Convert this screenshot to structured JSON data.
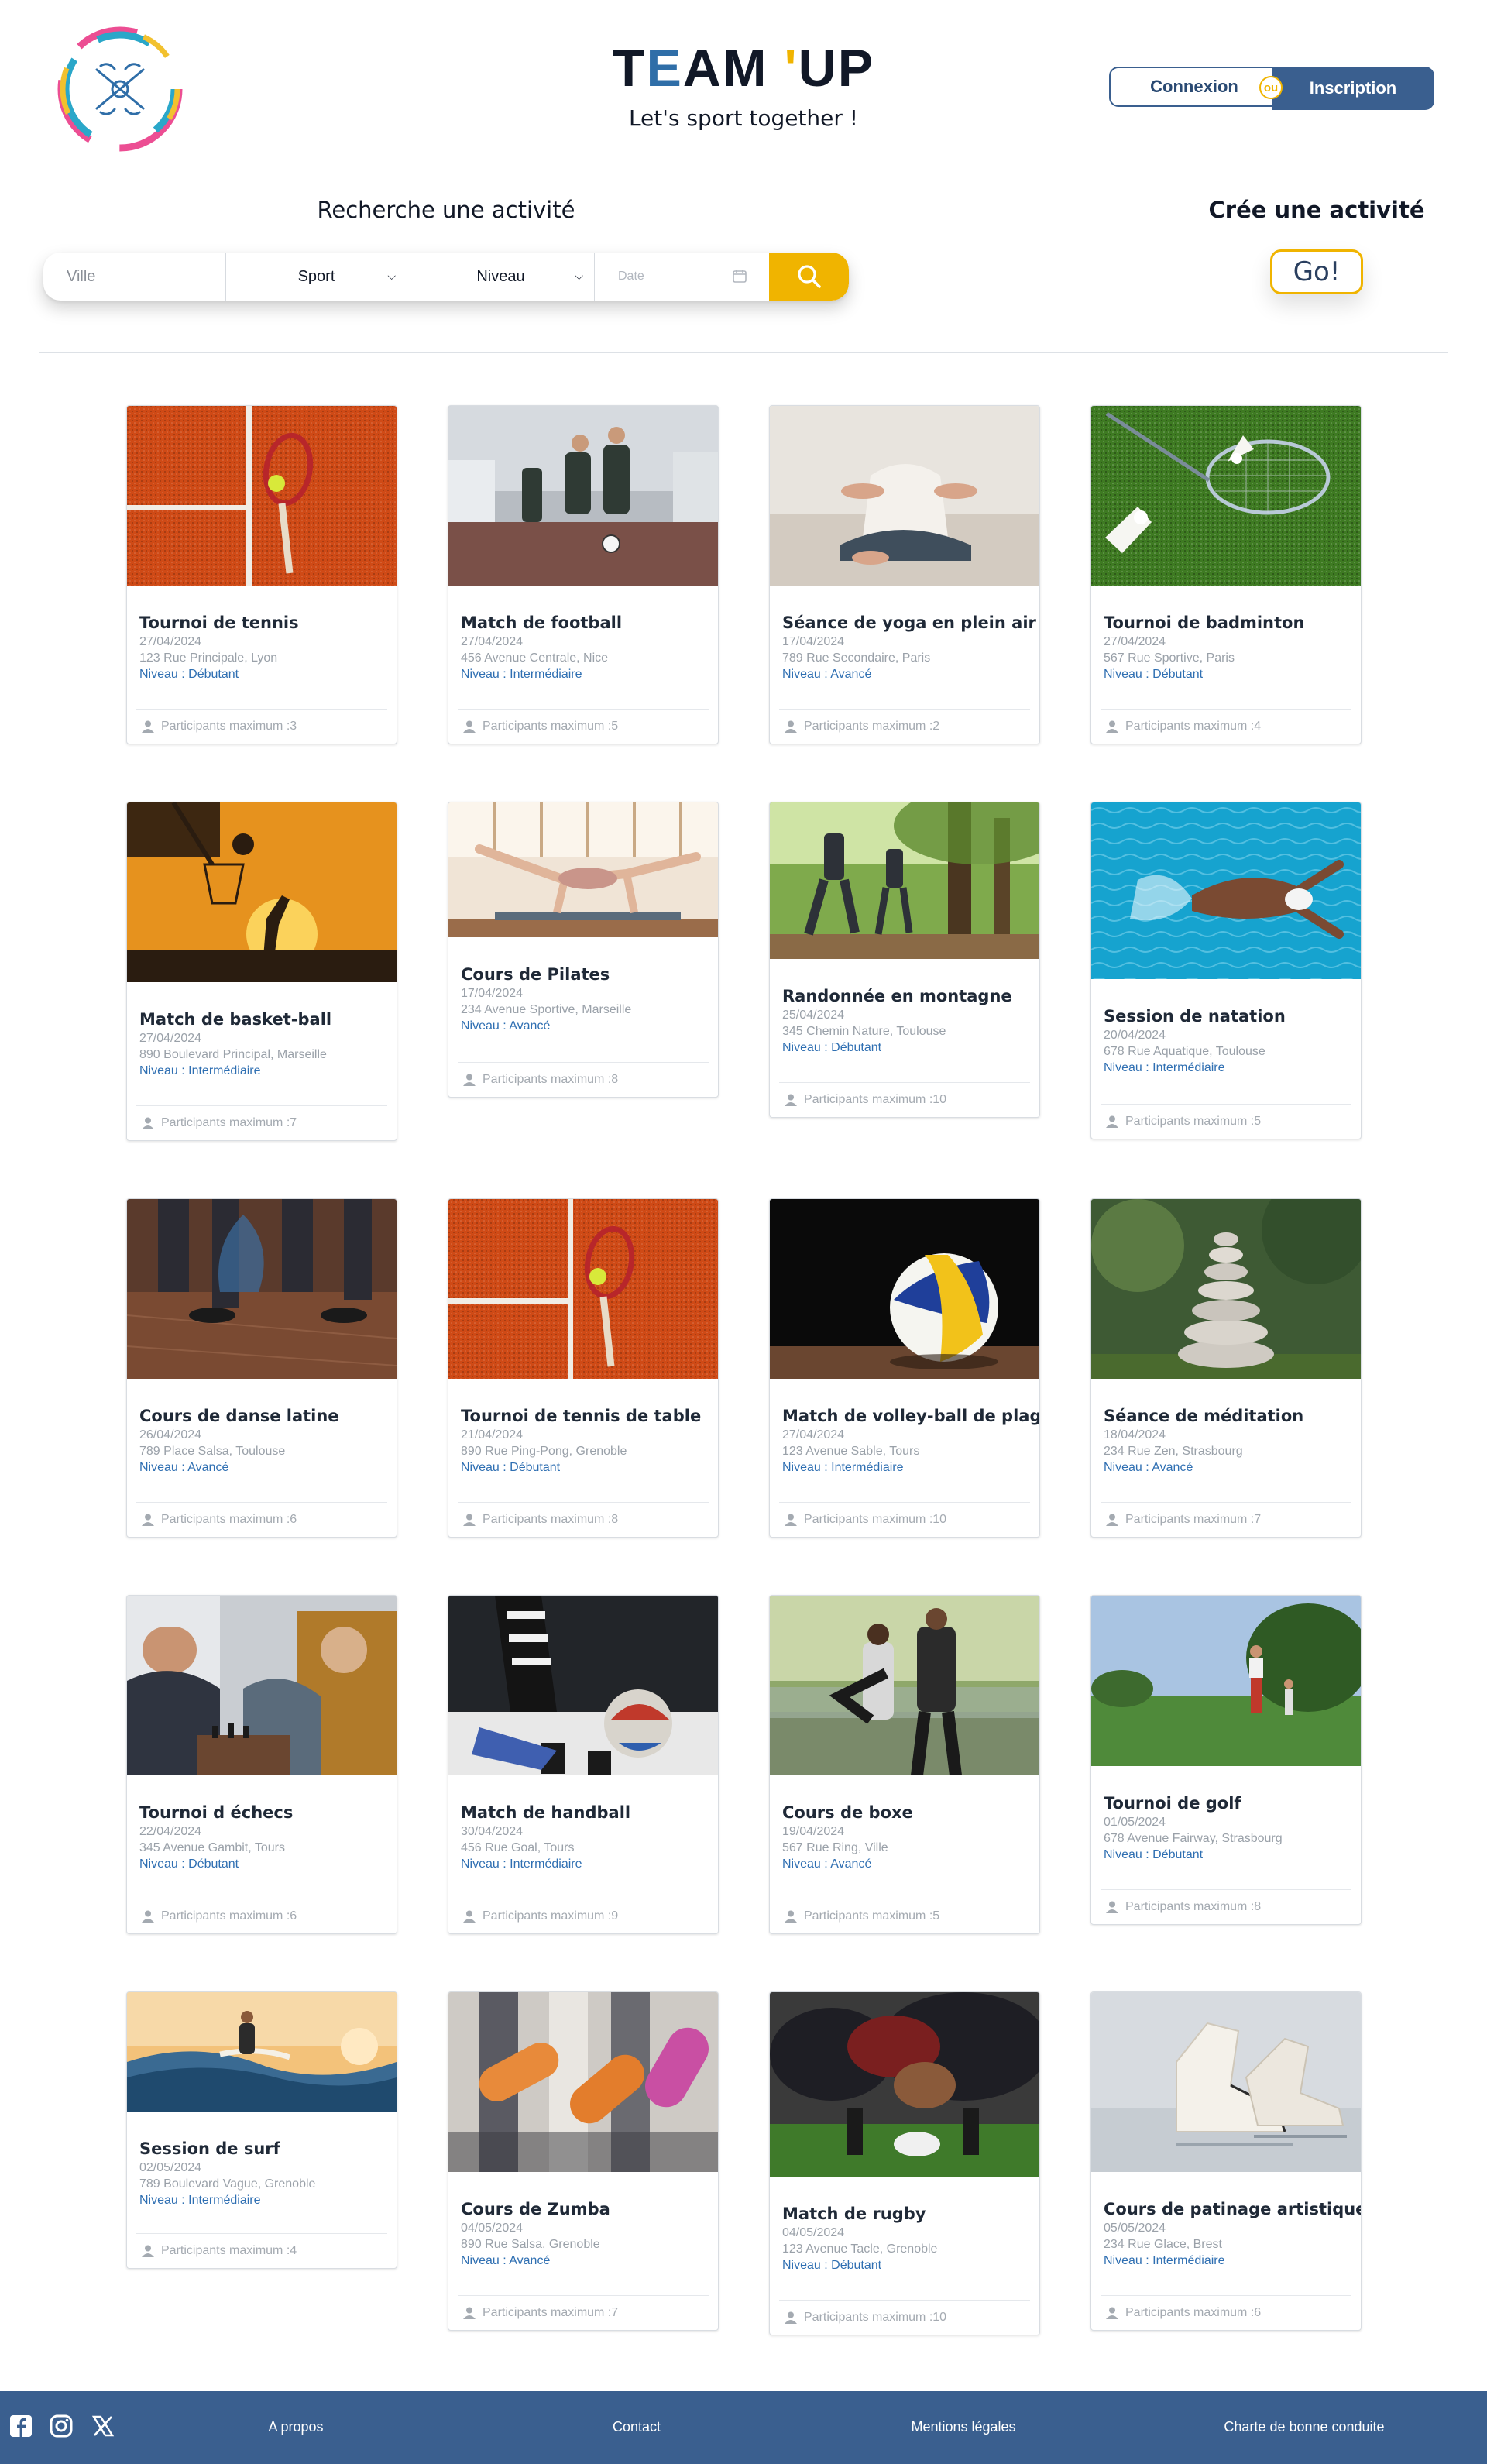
{
  "header": {
    "brand": {
      "t1": "T",
      "t2": "E",
      "t3": "AM ",
      "t4": "'",
      "t5": "UP"
    },
    "tagline": "Let's sport together !",
    "login_label": "Connexion",
    "or_label": "ou",
    "signup_label": "Inscription"
  },
  "search": {
    "title": "Recherche une activité",
    "city_placeholder": "Ville",
    "sport_value": "Sport",
    "level_value": "Niveau",
    "date_placeholder": "Date"
  },
  "create": {
    "title": "Crée une activité",
    "go_label": "Go!"
  },
  "participants_prefix": "Participants maximum :",
  "level_prefix": "Niveau : ",
  "activities": [
    {
      "title": "Tournoi de tennis",
      "date": "27/04/2024",
      "address": "123 Rue Principale, Lyon",
      "level": "Débutant",
      "max": "3",
      "image": "tennis"
    },
    {
      "title": "Match de football",
      "date": "27/04/2024",
      "address": "456 Avenue Centrale, Nice",
      "level": "Intermédiaire",
      "max": "5",
      "image": "football"
    },
    {
      "title": "Séance de yoga en plein air",
      "date": "17/04/2024",
      "address": "789 Rue Secondaire, Paris",
      "level": "Avancé",
      "max": "2",
      "image": "yoga"
    },
    {
      "title": "Tournoi de badminton",
      "date": "27/04/2024",
      "address": "567 Rue Sportive, Paris",
      "level": "Débutant",
      "max": "4",
      "image": "badminton"
    },
    {
      "title": "Match de basket-ball",
      "date": "27/04/2024",
      "address": "890 Boulevard Principal, Marseille",
      "level": "Intermédiaire",
      "max": "7",
      "image": "basketball"
    },
    {
      "title": "Cours de Pilates",
      "date": "17/04/2024",
      "address": "234 Avenue Sportive, Marseille",
      "level": "Avancé",
      "max": "8",
      "image": "pilates"
    },
    {
      "title": "Randonnée en montagne",
      "date": "25/04/2024",
      "address": "345 Chemin Nature, Toulouse",
      "level": "Débutant",
      "max": "10",
      "image": "hiking"
    },
    {
      "title": "Session de natation",
      "date": "20/04/2024",
      "address": "678 Rue Aquatique, Toulouse",
      "level": "Intermédiaire",
      "max": "5",
      "image": "swimming"
    },
    {
      "title": "Cours de danse latine",
      "date": "26/04/2024",
      "address": "789 Place Salsa, Toulouse",
      "level": "Avancé",
      "max": "6",
      "image": "dance"
    },
    {
      "title": "Tournoi de tennis de table",
      "date": "21/04/2024",
      "address": "890 Rue Ping-Pong, Grenoble",
      "level": "Débutant",
      "max": "8",
      "image": "tennis"
    },
    {
      "title": "Match de volley-ball de plage",
      "date": "27/04/2024",
      "address": "123 Avenue Sable, Tours",
      "level": "Intermédiaire",
      "max": "10",
      "image": "volleyball"
    },
    {
      "title": "Séance de méditation",
      "date": "18/04/2024",
      "address": "234 Rue Zen, Strasbourg",
      "level": "Avancé",
      "max": "7",
      "image": "meditation"
    },
    {
      "title": "Tournoi d échecs",
      "date": "22/04/2024",
      "address": "345 Avenue Gambit, Tours",
      "level": "Débutant",
      "max": "6",
      "image": "chess"
    },
    {
      "title": "Match de handball",
      "date": "30/04/2024",
      "address": "456 Rue Goal, Tours",
      "level": "Intermédiaire",
      "max": "9",
      "image": "handball"
    },
    {
      "title": "Cours de boxe",
      "date": "19/04/2024",
      "address": "567 Rue Ring, Ville",
      "level": "Avancé",
      "max": "5",
      "image": "boxing"
    },
    {
      "title": "Tournoi de golf",
      "date": "01/05/2024",
      "address": "678 Avenue Fairway, Strasbourg",
      "level": "Débutant",
      "max": "8",
      "image": "golf"
    },
    {
      "title": "Session de surf",
      "date": "02/05/2024",
      "address": "789 Boulevard Vague, Grenoble",
      "level": "Intermédiaire",
      "max": "4",
      "image": "surf"
    },
    {
      "title": "Cours de Zumba",
      "date": "04/05/2024",
      "address": "890 Rue Salsa, Grenoble",
      "level": "Avancé",
      "max": "7",
      "image": "zumba"
    },
    {
      "title": "Match de rugby",
      "date": "04/05/2024",
      "address": "123 Avenue Tacle, Grenoble",
      "level": "Débutant",
      "max": "10",
      "image": "rugby"
    },
    {
      "title": "Cours de patinage artistique",
      "date": "05/05/2024",
      "address": "234 Rue Glace, Brest",
      "level": "Intermédiaire",
      "max": "6",
      "image": "skating"
    }
  ],
  "footer": {
    "social": [
      "facebook-icon",
      "instagram-icon",
      "x-icon"
    ],
    "links": [
      "A propos",
      "Contact",
      "Mentions légales",
      "Charte de bonne conduite"
    ]
  },
  "colors": {
    "primary": "#3a5f8f",
    "accent": "#f0b400",
    "level": "#2f6fb2"
  }
}
